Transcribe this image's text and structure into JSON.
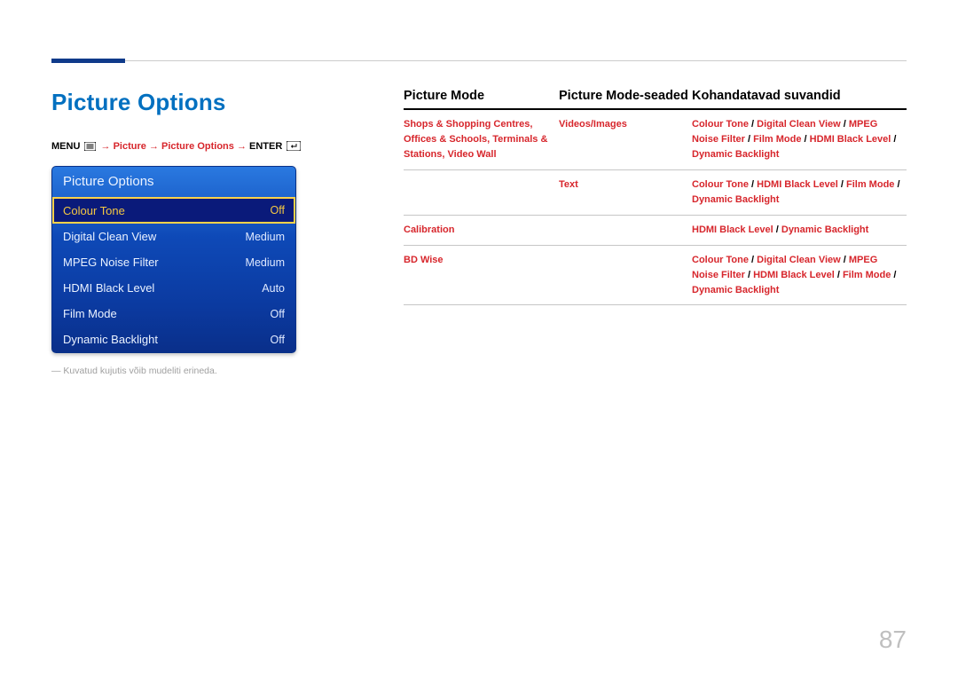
{
  "page_number": "87",
  "title": "Picture Options",
  "breadcrumb": {
    "menu": "MENU",
    "arrow": "→",
    "p1": "Picture",
    "p2": "Picture Options",
    "enter": "ENTER"
  },
  "osd": {
    "header": "Picture Options",
    "items": [
      {
        "label": "Colour Tone",
        "value": "Off",
        "selected": true
      },
      {
        "label": "Digital Clean View",
        "value": "Medium",
        "selected": false
      },
      {
        "label": "MPEG Noise Filter",
        "value": "Medium",
        "selected": false
      },
      {
        "label": "HDMI Black Level",
        "value": "Auto",
        "selected": false
      },
      {
        "label": "Film Mode",
        "value": "Off",
        "selected": false
      },
      {
        "label": "Dynamic Backlight",
        "value": "Off",
        "selected": false
      }
    ]
  },
  "footnote": "―  Kuvatud kujutis võib mudeliti erineda.",
  "table": {
    "headers": {
      "c1": "Picture Mode",
      "c2": "Picture Mode-seaded",
      "c3": "Kohandatavad suvandid"
    },
    "rows": [
      {
        "c1": "Shops & Shopping Centres, Offices & Schools, Terminals & Stations, Video Wall",
        "c2": "Videos/Images",
        "c3_parts": [
          "Colour Tone",
          " / ",
          "Digital Clean View",
          " / ",
          "MPEG Noise Filter",
          " / ",
          "Film Mode",
          " / ",
          "HDMI Black Level",
          " / ",
          "Dynamic Backlight"
        ]
      },
      {
        "c1": "",
        "c2": "Text",
        "c3_parts": [
          "Colour Tone",
          " / ",
          "HDMI Black Level",
          " / ",
          "Film Mode",
          " / ",
          "Dynamic Backlight"
        ]
      },
      {
        "c1": "Calibration",
        "c2": "",
        "c3_parts": [
          "HDMI Black Level",
          " / ",
          "Dynamic Backlight"
        ]
      },
      {
        "c1": "BD Wise",
        "c2": "",
        "c3_parts": [
          "Colour Tone",
          " / ",
          "Digital Clean View",
          " / ",
          "MPEG Noise Filter",
          " / ",
          "HDMI Black Level",
          " / ",
          "Film Mode",
          " / ",
          "Dynamic Backlight"
        ]
      }
    ]
  }
}
